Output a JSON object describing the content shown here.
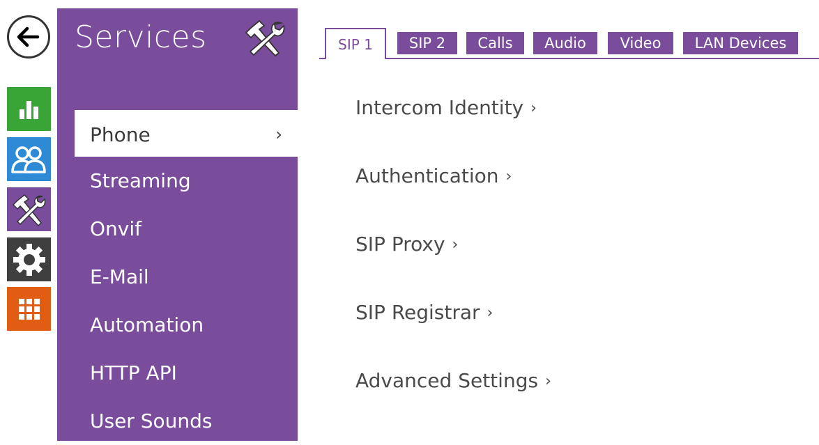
{
  "sidebar": {
    "title": "Services",
    "items": [
      {
        "label": "Phone",
        "active": true,
        "chevron": "›"
      },
      {
        "label": "Streaming"
      },
      {
        "label": "Onvif"
      },
      {
        "label": "E-Mail"
      },
      {
        "label": "Automation"
      },
      {
        "label": "HTTP API"
      },
      {
        "label": "User Sounds"
      }
    ]
  },
  "rail": {
    "buttons": [
      {
        "icon": "arrow-left-icon",
        "color": "#ffffff"
      },
      {
        "icon": "bar-chart-icon",
        "color": "#3aa537"
      },
      {
        "icon": "users-icon",
        "color": "#2f8ad6"
      },
      {
        "icon": "tools-icon",
        "color": "#7a4d9c"
      },
      {
        "icon": "gear-icon",
        "color": "#3f3f3f"
      },
      {
        "icon": "grid-icon",
        "color": "#e15d13"
      }
    ]
  },
  "tabs": [
    {
      "label": "SIP 1",
      "active": true
    },
    {
      "label": "SIP 2"
    },
    {
      "label": "Calls"
    },
    {
      "label": "Audio"
    },
    {
      "label": "Video"
    },
    {
      "label": "LAN Devices"
    }
  ],
  "sections": [
    {
      "label": "Intercom Identity",
      "arrow": "›"
    },
    {
      "label": "Authentication",
      "arrow": "›"
    },
    {
      "label": "SIP Proxy",
      "arrow": "›"
    },
    {
      "label": "SIP Registrar",
      "arrow": "›"
    },
    {
      "label": "Advanced Settings",
      "arrow": "›"
    }
  ],
  "colors": {
    "accent": "#7a4d9c",
    "text": "#4a4a4a"
  }
}
